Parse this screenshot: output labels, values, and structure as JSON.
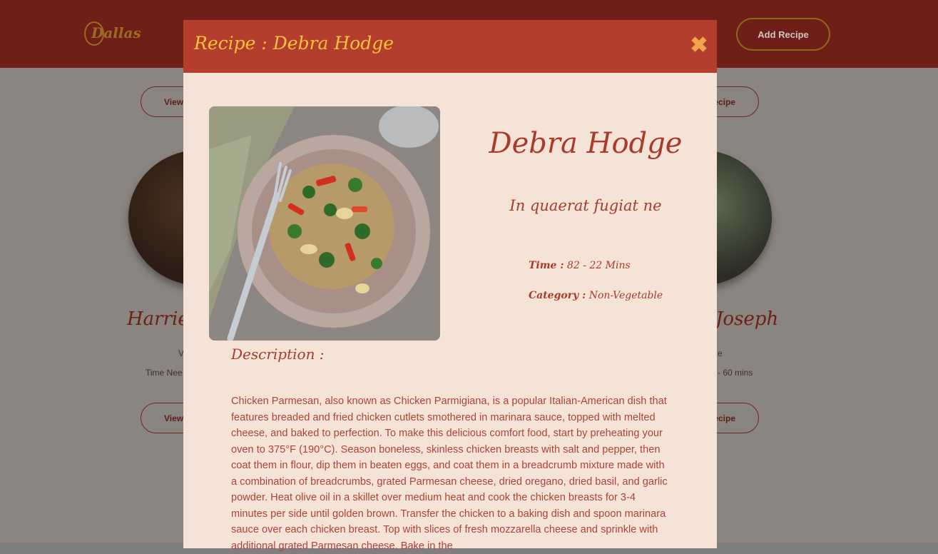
{
  "navbar": {
    "logo_text": "Dallas",
    "add_recipe_label": "Add Recipe"
  },
  "background": {
    "top_left_button": "View",
    "top_right_button": "ecipe",
    "bottom_left_button": "View",
    "bottom_right_button": "ecipe",
    "left_card_name": "Harriet",
    "right_card_name": "Joseph",
    "left_card_sub": "V",
    "right_card_sub": "e",
    "left_card_time": "Time Nee",
    "right_card_time": "- 60 mins"
  },
  "modal": {
    "title": "Recipe : Debra Hodge",
    "close_symbol": "✖",
    "recipe_name": "Debra Hodge",
    "subtitle": "In quaerat fugiat ne",
    "time_label": "Time :",
    "time_value": "82 - 22 Mins",
    "category_label": "Category :",
    "category_value": "Non-Vegetable",
    "description_heading": "Description :",
    "description": "Chicken Parmesan, also known as Chicken Parmigiana, is a popular Italian-American dish that features breaded and fried chicken cutlets smothered in marinara sauce, topped with melted cheese, and baked to perfection. To make this delicious comfort food, start by preheating your oven to 375°F (190°C). Season boneless, skinless chicken breasts with salt and pepper, then coat them in flour, dip them in beaten eggs, and coat them in a breadcrumb mixture made with a combination of breadcrumbs, grated Parmesan cheese, dried oregano, dried basil, and garlic powder. Heat olive oil in a skillet over medium heat and cook the chicken breasts for 3-4 minutes per side until golden brown. Transfer the chicken to a baking dish and spoon marinara sauce over each chicken breast. Top with slices of fresh mozzarella cheese and sprinkle with additional grated Parmesan cheese. Bake in the"
  },
  "colors": {
    "header": "#b33e2e",
    "title_accent": "#f7c23c",
    "modal_bg": "#f5e3d8",
    "text_red": "#a93a2c"
  },
  "icons": {
    "close": "close-icon",
    "logo": "chef-hat-logo"
  }
}
